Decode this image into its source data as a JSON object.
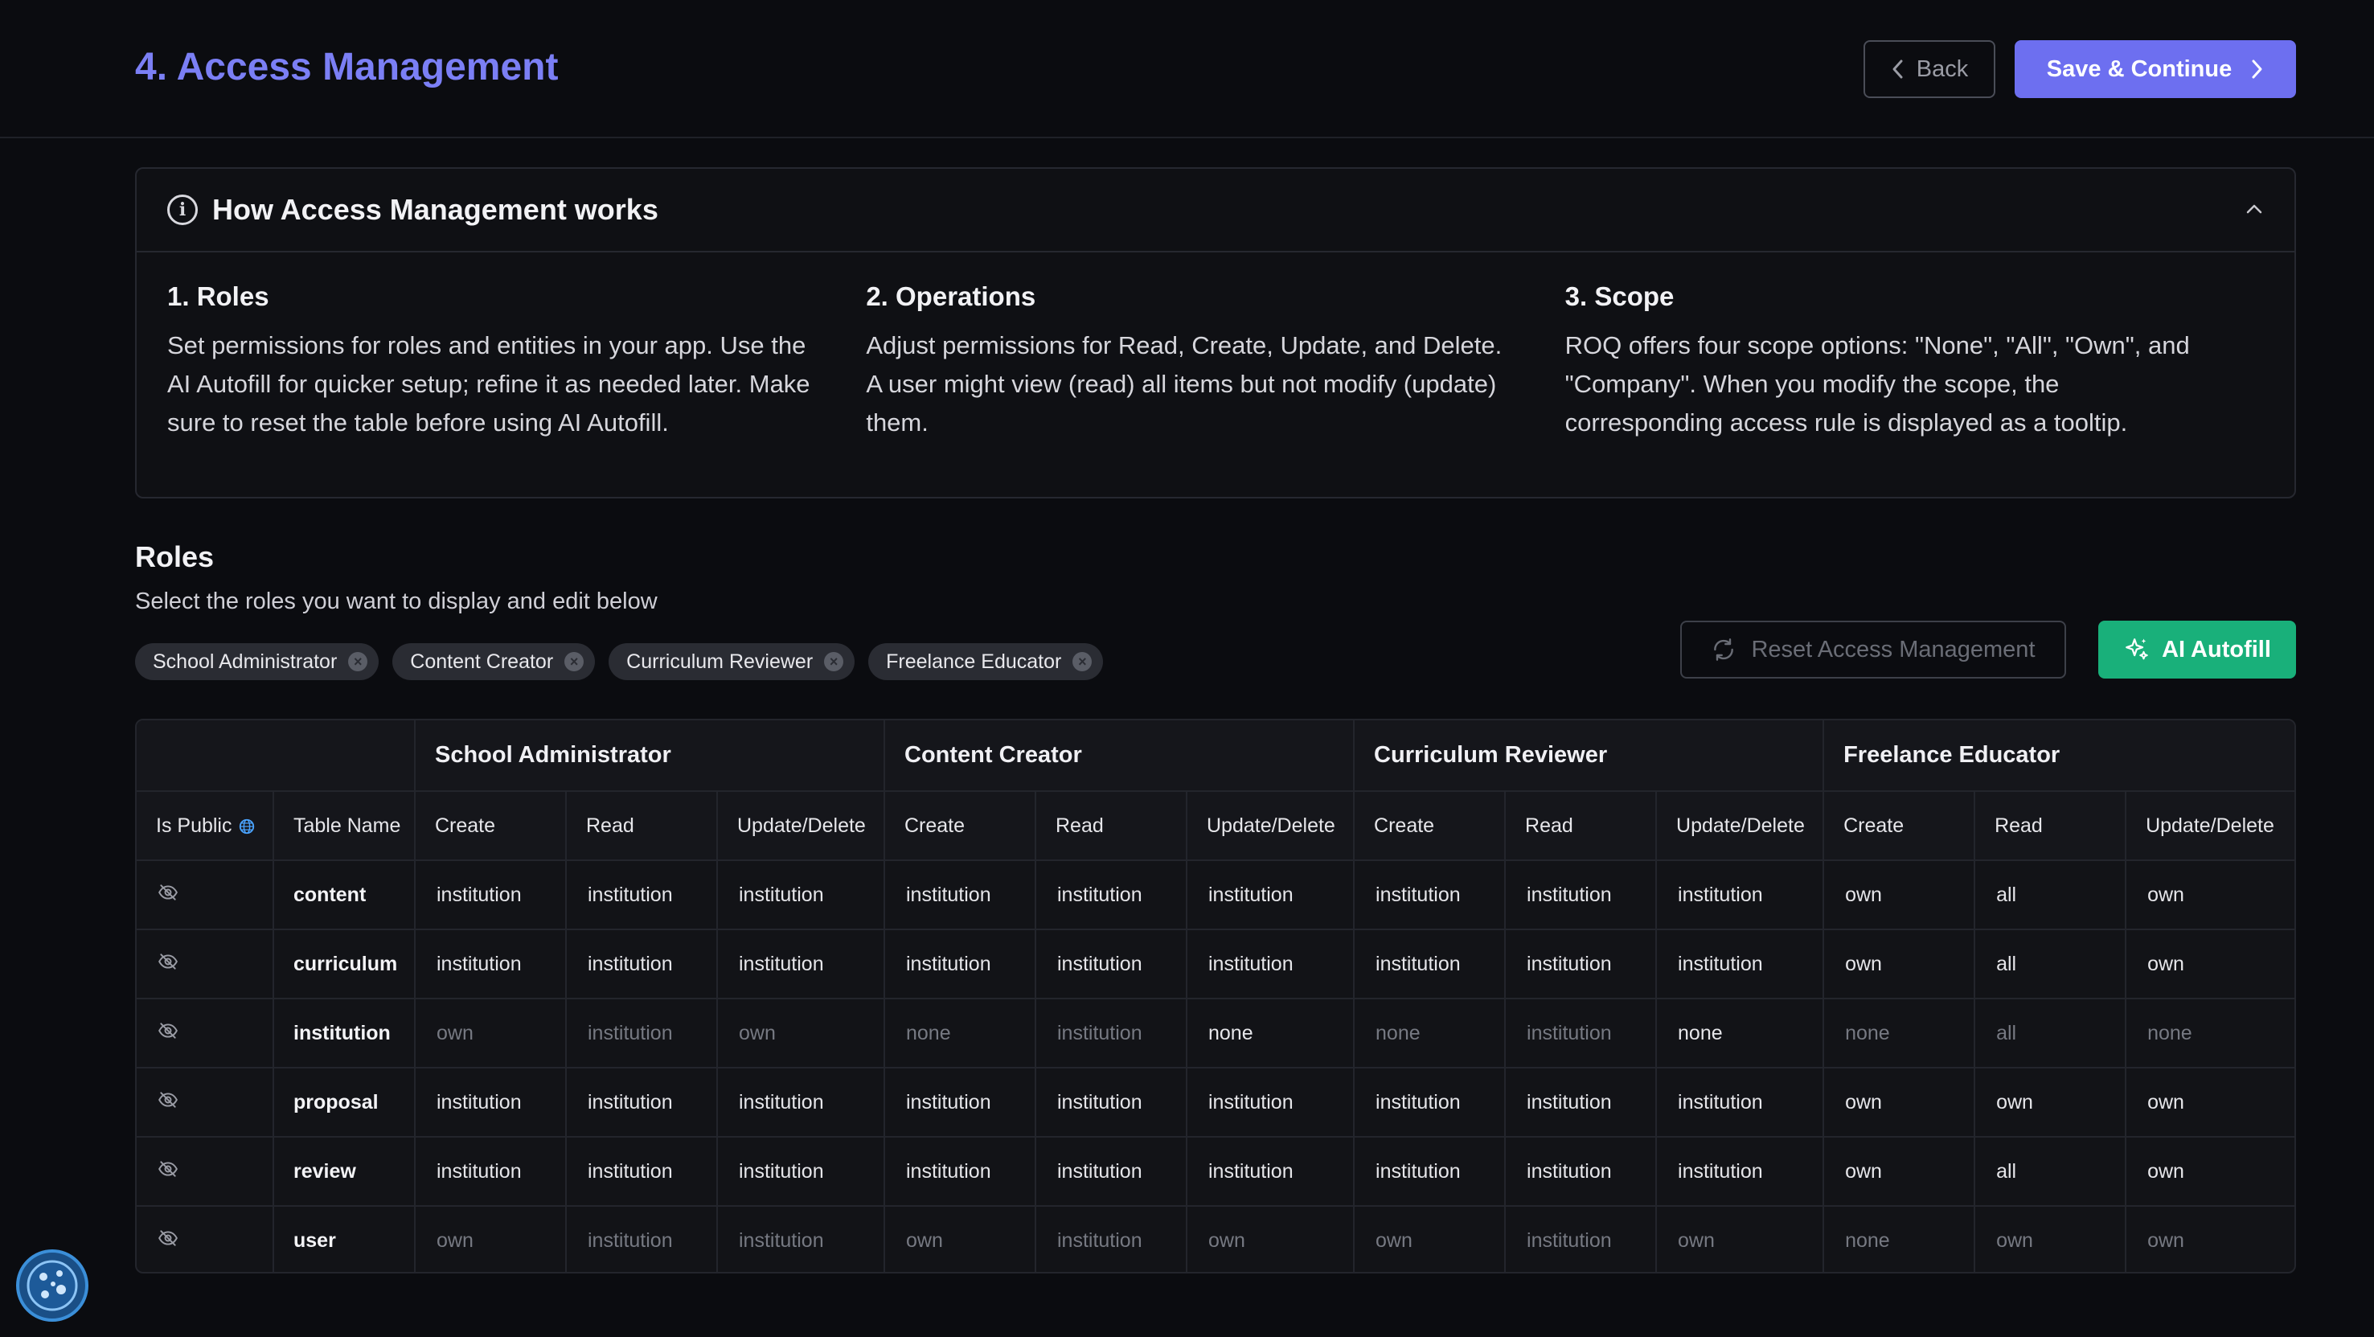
{
  "header": {
    "title": "4. Access Management",
    "back_label": "Back",
    "save_label": "Save & Continue"
  },
  "info": {
    "title": "How Access Management works",
    "columns": [
      {
        "heading": "1. Roles",
        "text": "Set permissions for roles and entities in your app. Use the AI Autofill for quicker setup; refine it as needed later. Make sure to reset the table before using AI Autofill."
      },
      {
        "heading": "2. Operations",
        "text": "Adjust permissions for Read, Create, Update, and Delete. A user might view (read) all items but not modify (update) them."
      },
      {
        "heading": "3. Scope",
        "text": "ROQ offers four scope options: \"None\", \"All\", \"Own\", and \"Company\". When you modify the scope, the corresponding access rule is displayed as a tooltip."
      }
    ]
  },
  "roles": {
    "title": "Roles",
    "subtitle": "Select the roles you want to display and edit below",
    "chips": [
      "School Administrator",
      "Content Creator",
      "Curriculum Reviewer",
      "Freelance Educator"
    ],
    "reset_label": "Reset Access Management",
    "autofill_label": "AI Autofill"
  },
  "table": {
    "groups": [
      "School Administrator",
      "Content Creator",
      "Curriculum Reviewer",
      "Freelance Educator"
    ],
    "is_public_label": "Is Public",
    "table_name_label": "Table Name",
    "ops": [
      "Create",
      "Read",
      "Update/Delete"
    ],
    "rows": [
      {
        "name": "content",
        "muted": false,
        "cells": [
          "institution",
          "institution",
          "institution",
          "institution",
          "institution",
          "institution",
          "institution",
          "institution",
          "institution",
          "own",
          "all",
          "own"
        ]
      },
      {
        "name": "curriculum",
        "muted": false,
        "cells": [
          "institution",
          "institution",
          "institution",
          "institution",
          "institution",
          "institution",
          "institution",
          "institution",
          "institution",
          "own",
          "all",
          "own"
        ]
      },
      {
        "name": "institution",
        "muted": true,
        "cells": [
          "own",
          "institution",
          "own",
          "none",
          "institution",
          "none",
          "none",
          "institution",
          "none",
          "none",
          "all",
          "none"
        ]
      },
      {
        "name": "proposal",
        "muted": false,
        "cells": [
          "institution",
          "institution",
          "institution",
          "institution",
          "institution",
          "institution",
          "institution",
          "institution",
          "institution",
          "own",
          "own",
          "own"
        ]
      },
      {
        "name": "review",
        "muted": false,
        "cells": [
          "institution",
          "institution",
          "institution",
          "institution",
          "institution",
          "institution",
          "institution",
          "institution",
          "institution",
          "own",
          "all",
          "own"
        ]
      },
      {
        "name": "user",
        "muted": true,
        "cells": [
          "own",
          "institution",
          "institution",
          "own",
          "institution",
          "own",
          "own",
          "institution",
          "own",
          "none",
          "own",
          "own"
        ]
      }
    ],
    "bright_cells": {
      "institution": [
        5,
        8
      ]
    }
  }
}
